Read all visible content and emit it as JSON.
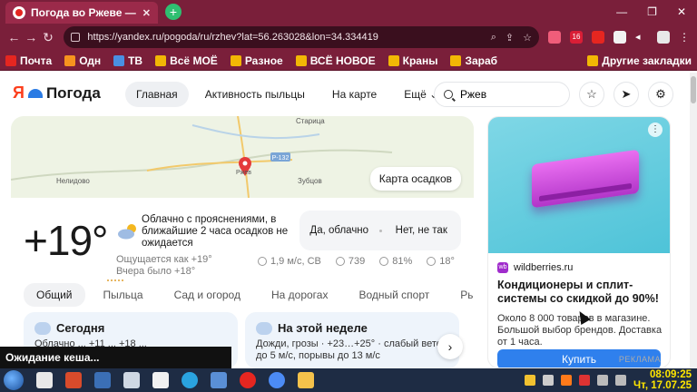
{
  "browser": {
    "tab_title": "Погода во Ржеве —",
    "tab_close": "✕",
    "new_tab": "+",
    "window_controls": [
      "—",
      "❐",
      "✕"
    ],
    "url": "https://yandex.ru/pogoda/ru/rzhev?lat=56.263028&lon=34.334419",
    "bookmarks": [
      {
        "label": "Почта",
        "color": "#e52620"
      },
      {
        "label": "Одн",
        "color": "#f7931e"
      },
      {
        "label": "ТВ",
        "color": "#4a90e2"
      },
      {
        "label": "Всё МОЁ",
        "color": "#f2b705"
      },
      {
        "label": "Разное",
        "color": "#f2b705"
      },
      {
        "label": "ВСЁ НОВОЕ",
        "color": "#f2b705"
      },
      {
        "label": "Краны",
        "color": "#f2b705"
      },
      {
        "label": "Зараб",
        "color": "#f2b705"
      }
    ],
    "other_bookmarks": "Другие закладки",
    "ext_badge": "16"
  },
  "header": {
    "logo_ya": "Я",
    "logo_brand": "Погода",
    "nav": [
      "Главная",
      "Активность пыльцы",
      "На карте",
      "Ещё ⌄"
    ],
    "search_value": "Ржев"
  },
  "map": {
    "labels": {
      "staritsa": "Старица",
      "nelidovo": "Нелидово",
      "zubtsov": "Зубцов",
      "rzhev": "Ржев",
      "road": "Р-132"
    },
    "button": "Карта осадков"
  },
  "weather": {
    "temperature": "+19°",
    "condition": "Облачно с прояснениями, в ближайшие 2 часа осадков не ожидается",
    "feels_like": "Ощущается как +19°",
    "yesterday": "Вчера было +18°",
    "feedback_yes": "Да, облачно",
    "feedback_no": "Нет, не так",
    "wind": "1,9 м/с, СВ",
    "pressure": "739",
    "humidity": "81%",
    "water_temp": "18°",
    "subtabs": [
      "Общий",
      "Пыльца",
      "Сад и огород",
      "На дорогах",
      "Водный спорт",
      "Рыбалка"
    ],
    "today_title": "Сегодня",
    "today_text": "Облачно ... +11 ... +18 ...",
    "week_title": "На этой неделе",
    "week_text": "Дожди, грозы · +23…+25° · слабый ветер до 5 м/с, порывы до 13 м/с",
    "next": "›"
  },
  "ad": {
    "brand": "wildberries.ru",
    "title": "Кондиционеры и сплит-системы со скидкой до 90%!",
    "text": "Около 8 000 товаров в магазине. Большой выбор брендов. Доставка от 1 часа.",
    "button": "Купить",
    "label": "РЕКЛАМА",
    "menu": "⋮"
  },
  "taskbar": {
    "popup": "Ожидание кеша...",
    "time": "08:09:25",
    "date": "Чт, 17.07.25"
  }
}
